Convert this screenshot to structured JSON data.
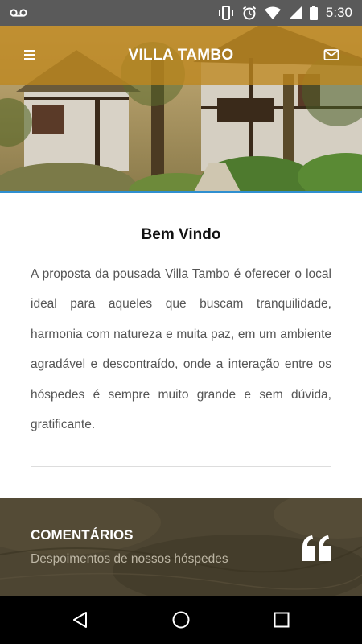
{
  "status_bar": {
    "time": "5:30",
    "icons": [
      "voicemail-icon",
      "vibrate-icon",
      "alarm-icon",
      "wifi-icon",
      "signal-icon",
      "battery-icon"
    ]
  },
  "app_bar": {
    "title": "VILLA TAMBO",
    "menu_icon": "menu-icon",
    "mail_icon": "mail-icon",
    "color": "#be871e"
  },
  "welcome": {
    "heading": "Bem Vindo",
    "body": "A proposta da pousada Villa Tambo é oferecer o local ideal para aqueles que buscam tranquilidade, harmonia com natureza e muita paz, em um ambiente agradável e descontraído, onde a interação entre os hóspedes é sempre muito grande e sem dúvida, gratificante."
  },
  "comments": {
    "heading": "COMENTÁRIOS",
    "subtitle": "Despoimentos de nossos hóspedes",
    "icon": "quote-icon"
  },
  "nav_bar": {
    "icons": [
      "back-icon",
      "home-icon",
      "recents-icon"
    ]
  },
  "colors": {
    "accent_line": "#2f8fd0",
    "status_bar": "#5a5a5a"
  }
}
